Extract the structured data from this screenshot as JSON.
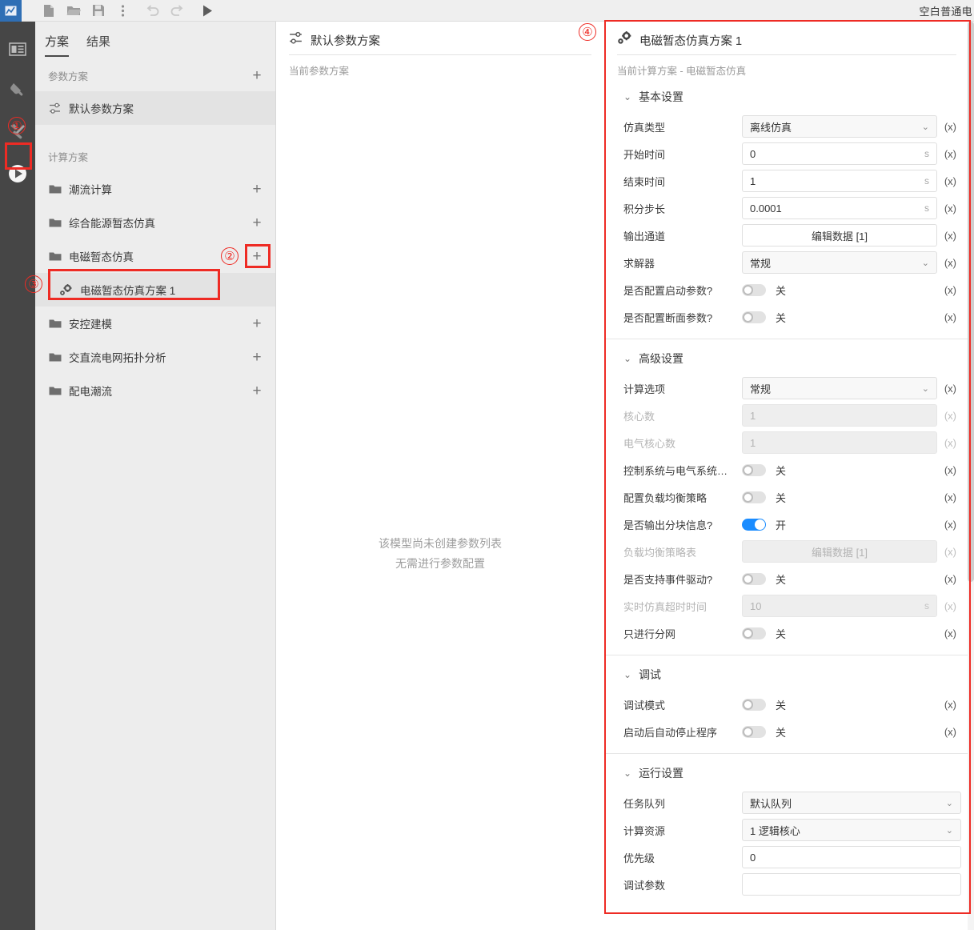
{
  "toolbar": {
    "logo_icon": "app-logo-icon",
    "buttons": [
      {
        "name": "new-file-icon",
        "glyph": "file"
      },
      {
        "name": "open-folder-icon",
        "glyph": "folder"
      },
      {
        "name": "save-icon",
        "glyph": "save"
      },
      {
        "name": "more-options-icon",
        "glyph": "dots"
      },
      {
        "name": "undo-icon",
        "glyph": "undo"
      },
      {
        "name": "redo-icon",
        "glyph": "redo"
      },
      {
        "name": "run-icon",
        "glyph": "play"
      }
    ],
    "document_title": "空白普通电"
  },
  "rail": {
    "items": [
      {
        "name": "sidebar-rail-library",
        "icon": "library-icon",
        "active": false
      },
      {
        "name": "sidebar-rail-device",
        "icon": "plug-icon",
        "active": false
      },
      {
        "name": "sidebar-rail-tools",
        "icon": "hammer-wrench-icon",
        "active": false
      },
      {
        "name": "sidebar-rail-run",
        "icon": "play-circle-icon",
        "active": true
      }
    ]
  },
  "scheme_panel": {
    "tabs": [
      {
        "label": "方案",
        "selected": true
      },
      {
        "label": "结果",
        "selected": false
      }
    ],
    "param_section": {
      "label": "参数方案",
      "add_label": "+",
      "items": [
        {
          "label": "默认参数方案",
          "icon": "sliders-icon",
          "highlight": true
        }
      ]
    },
    "calc_section": {
      "label": "计算方案",
      "folders": [
        {
          "label": "潮流计算",
          "icon": "folder-icon",
          "add_label": "+"
        },
        {
          "label": "综合能源暂态仿真",
          "icon": "folder-icon",
          "add_label": "+"
        },
        {
          "label": "电磁暂态仿真",
          "icon": "folder-icon",
          "add_label": "+"
        },
        {
          "label": "安控建模",
          "icon": "folder-icon",
          "add_label": "+"
        },
        {
          "label": "交直流电网拓扑分析",
          "icon": "folder-icon",
          "add_label": "+"
        },
        {
          "label": "配电潮流",
          "icon": "folder-icon",
          "add_label": "+"
        }
      ],
      "selected_child": {
        "label": "电磁暂态仿真方案 1",
        "icon": "gears-icon"
      }
    }
  },
  "mid_panel": {
    "title": "默认参数方案",
    "title_icon": "sliders-icon",
    "subtitle": "当前参数方案",
    "empty_line1": "该模型尚未创建参数列表",
    "empty_line2": "无需进行参数配置"
  },
  "prop_panel": {
    "title": "电磁暂态仿真方案 1",
    "title_icon": "gears-icon",
    "subtitle": "当前计算方案 - 电磁暂态仿真",
    "groups": [
      {
        "name": "basic-settings",
        "label": "基本设置",
        "chevron": "⌄",
        "rows": [
          {
            "label": "仿真类型",
            "type": "select",
            "value": "离线仿真",
            "fx": "(x)",
            "disabled": false
          },
          {
            "label": "开始时间",
            "type": "input",
            "value": "0",
            "unit": "s",
            "fx": "(x)",
            "disabled": false
          },
          {
            "label": "结束时间",
            "type": "input",
            "value": "1",
            "unit": "s",
            "fx": "(x)",
            "disabled": false
          },
          {
            "label": "积分步长",
            "type": "input",
            "value": "0.0001",
            "unit": "s",
            "fx": "(x)",
            "disabled": false
          },
          {
            "label": "输出通道",
            "type": "button",
            "value": "编辑数据 [1]",
            "fx": "(x)",
            "disabled": false
          },
          {
            "label": "求解器",
            "type": "select",
            "value": "常规",
            "fx": "(x)",
            "disabled": false
          },
          {
            "label": "是否配置启动参数?",
            "type": "toggle",
            "on": false,
            "state": "关",
            "fx": "(x)",
            "disabled": false
          },
          {
            "label": "是否配置断面参数?",
            "type": "toggle",
            "on": false,
            "state": "关",
            "fx": "(x)",
            "disabled": false
          }
        ]
      },
      {
        "name": "advanced-settings",
        "label": "高级设置",
        "chevron": "⌄",
        "rows": [
          {
            "label": "计算选项",
            "type": "select",
            "value": "常规",
            "fx": "(x)",
            "disabled": false
          },
          {
            "label": "核心数",
            "type": "input",
            "value": "1",
            "unit": "",
            "fx": "(x)",
            "disabled": true
          },
          {
            "label": "电气核心数",
            "type": "input",
            "value": "1",
            "unit": "",
            "fx": "(x)",
            "disabled": true
          },
          {
            "label": "控制系统与电气系统…",
            "type": "toggle",
            "on": false,
            "state": "关",
            "fx": "(x)",
            "disabled": false
          },
          {
            "label": "配置负载均衡策略",
            "type": "toggle",
            "on": false,
            "state": "关",
            "fx": "(x)",
            "disabled": false
          },
          {
            "label": "是否输出分块信息?",
            "type": "toggle",
            "on": true,
            "state": "开",
            "fx": "(x)",
            "disabled": false
          },
          {
            "label": "负载均衡策略表",
            "type": "button",
            "value": "编辑数据 [1]",
            "fx": "(x)",
            "disabled": true
          },
          {
            "label": "是否支持事件驱动?",
            "type": "toggle",
            "on": false,
            "state": "关",
            "fx": "(x)",
            "disabled": false
          },
          {
            "label": "实时仿真超时时间",
            "type": "input",
            "value": "10",
            "unit": "s",
            "fx": "(x)",
            "disabled": true
          },
          {
            "label": "只进行分网",
            "type": "toggle",
            "on": false,
            "state": "关",
            "fx": "(x)",
            "disabled": false
          }
        ]
      },
      {
        "name": "debug-settings",
        "label": "调试",
        "chevron": "⌄",
        "rows": [
          {
            "label": "调试模式",
            "type": "toggle",
            "on": false,
            "state": "关",
            "fx": "(x)",
            "disabled": false
          },
          {
            "label": "启动后自动停止程序",
            "type": "toggle",
            "on": false,
            "state": "关",
            "fx": "(x)",
            "disabled": false
          }
        ]
      },
      {
        "name": "run-settings",
        "label": "运行设置",
        "chevron": "⌄",
        "wide": true,
        "rows": [
          {
            "label": "任务队列",
            "type": "select",
            "value": "默认队列",
            "fx": "",
            "disabled": false
          },
          {
            "label": "计算资源",
            "type": "select",
            "value": "1 逻辑核心",
            "fx": "",
            "disabled": false
          },
          {
            "label": "优先级",
            "type": "input",
            "value": "0",
            "unit": "",
            "fx": "",
            "disabled": false
          },
          {
            "label": "调试参数",
            "type": "input",
            "value": "",
            "unit": "",
            "fx": "",
            "disabled": false
          }
        ]
      }
    ]
  },
  "annotations": [
    {
      "label": "①",
      "name": "annotation-1"
    },
    {
      "label": "②",
      "name": "annotation-2"
    },
    {
      "label": "③",
      "name": "annotation-3"
    },
    {
      "label": "④",
      "name": "annotation-4"
    }
  ],
  "colors": {
    "accent_red": "#ee2b24",
    "toggle_on": "#1a8cff",
    "rail_bg": "#464646",
    "panel_bg": "#ededed",
    "logo_blue": "#2f6fb5"
  }
}
